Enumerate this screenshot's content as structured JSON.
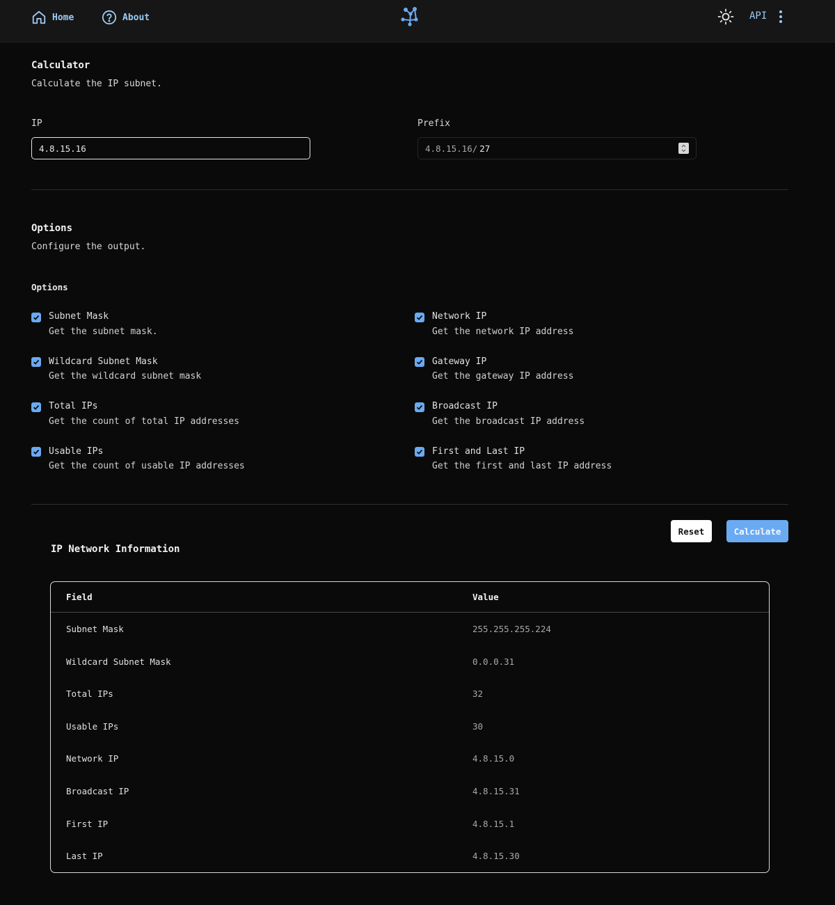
{
  "nav": {
    "home": "Home",
    "about": "About",
    "api": "API"
  },
  "calculator": {
    "title": "Calculator",
    "subtitle": "Calculate the IP subnet.",
    "ip_label": "IP",
    "ip_value": "4.8.15.16",
    "prefix_label": "Prefix",
    "prefix_fixed": "4.8.15.16/",
    "prefix_value": "27"
  },
  "options": {
    "title": "Options",
    "subtitle": "Configure the output.",
    "group_label": "Options",
    "left": [
      {
        "label": "Subnet Mask",
        "desc": "Get the subnet mask.",
        "checked": true
      },
      {
        "label": "Wildcard Subnet Mask",
        "desc": "Get the wildcard subnet mask",
        "checked": true
      },
      {
        "label": "Total IPs",
        "desc": "Get the count of total IP addresses",
        "checked": true
      },
      {
        "label": "Usable IPs",
        "desc": "Get the count of usable IP addresses",
        "checked": true
      }
    ],
    "right": [
      {
        "label": "Network IP",
        "desc": "Get the network IP address",
        "checked": true
      },
      {
        "label": "Gateway IP",
        "desc": "Get the gateway IP address",
        "checked": true
      },
      {
        "label": "Broadcast IP",
        "desc": "Get the broadcast IP address",
        "checked": true
      },
      {
        "label": "First and Last IP",
        "desc": "Get the first and last IP address",
        "checked": true
      }
    ]
  },
  "actions": {
    "reset": "Reset",
    "calculate": "Calculate"
  },
  "results": {
    "title": "IP Network Information",
    "col_field": "Field",
    "col_value": "Value",
    "rows": [
      {
        "field": "Subnet Mask",
        "value": "255.255.255.224"
      },
      {
        "field": "Wildcard Subnet Mask",
        "value": "0.0.0.31"
      },
      {
        "field": "Total IPs",
        "value": "32"
      },
      {
        "field": "Usable IPs",
        "value": "30"
      },
      {
        "field": "Network IP",
        "value": "4.8.15.0"
      },
      {
        "field": "Broadcast IP",
        "value": "4.8.15.31"
      },
      {
        "field": "First IP",
        "value": "4.8.15.1"
      },
      {
        "field": "Last IP",
        "value": "4.8.15.30"
      }
    ]
  },
  "colors": {
    "accent": "#6aaaf2",
    "link": "#9cc9f5",
    "background": "#0a0a0a",
    "header": "#161616"
  }
}
